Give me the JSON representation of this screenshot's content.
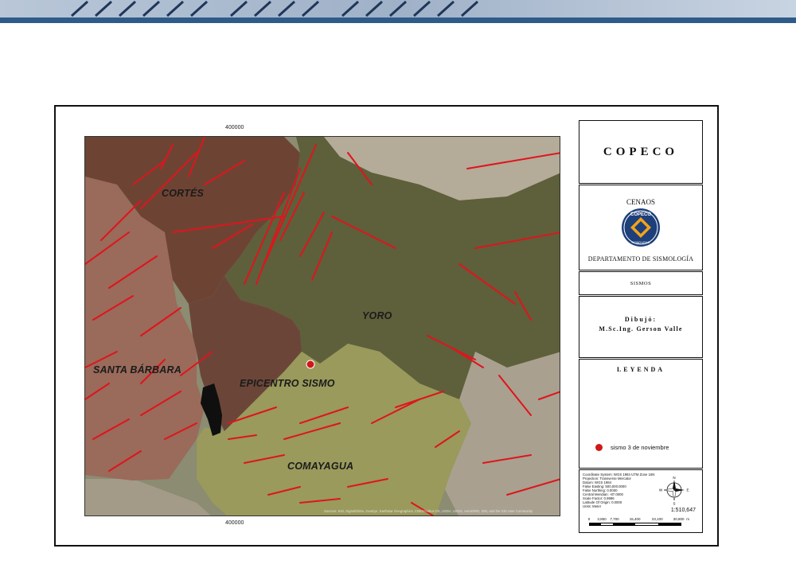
{
  "colors": {
    "brand_blue": "#2f5b8a",
    "fault_red": "#e0141c",
    "epicenter_red": "#d01818",
    "cortes_fill": "#6e4536",
    "yoro_fill": "#5f5f3c",
    "comayagua_fill": "#9a9a5c",
    "santa_barbara_fill": "#9c6c5c"
  },
  "map": {
    "grid_label_top": "400000",
    "grid_label_bottom": "400000",
    "departments": [
      {
        "name": "CORTÉS"
      },
      {
        "name": "YORO"
      },
      {
        "name": "SANTA BÁRBARA"
      },
      {
        "name": "COMAYAGUA"
      }
    ],
    "epicenter_label": "EPICENTRO SISMO",
    "attribution": "Sources: Esri, DigitalGlobe, GeoEye, Earthstar Geographics, CNES/Airbus DS, USDA, USGS, AeroGRID, IGN, and the GIS User Community"
  },
  "panel": {
    "title": "COPECO",
    "cenaos": "CENAOS",
    "logo_top": "COPECO",
    "logo_bottom": "HONDURAS",
    "department": "DEPARTAMENTO DE SISMOLOGÍA",
    "sismos": "SISMOS",
    "dibujo_label": "Dibujó:",
    "author": "M.Sc.Ing. Gerson Valle",
    "leyenda": "LEYENDA",
    "legend_items": [
      {
        "label": "sismo 3 de noviembre",
        "color": "#d01818"
      }
    ]
  },
  "metadata": {
    "lines": [
      "Coordinate System: WGS 1984 UTM Zone 16N",
      "Projection: Transverse Mercator",
      "Datum: WGS 1984",
      "False Easting: 500,000.0000",
      "False Northing: 0.0000",
      "Central Meridian: -87.0000",
      "Scale Factor: 0.9996",
      "Latitude Of Origin: 0.0000",
      "Units: Meter"
    ]
  },
  "compass": {
    "n": "N",
    "s": "S",
    "e": "E",
    "w": "W"
  },
  "scale": {
    "ratio": "1:510,647",
    "ticks": [
      "0",
      "3,850",
      "7,700",
      "15,400",
      "23,100",
      "30,800"
    ],
    "unit": "m"
  }
}
